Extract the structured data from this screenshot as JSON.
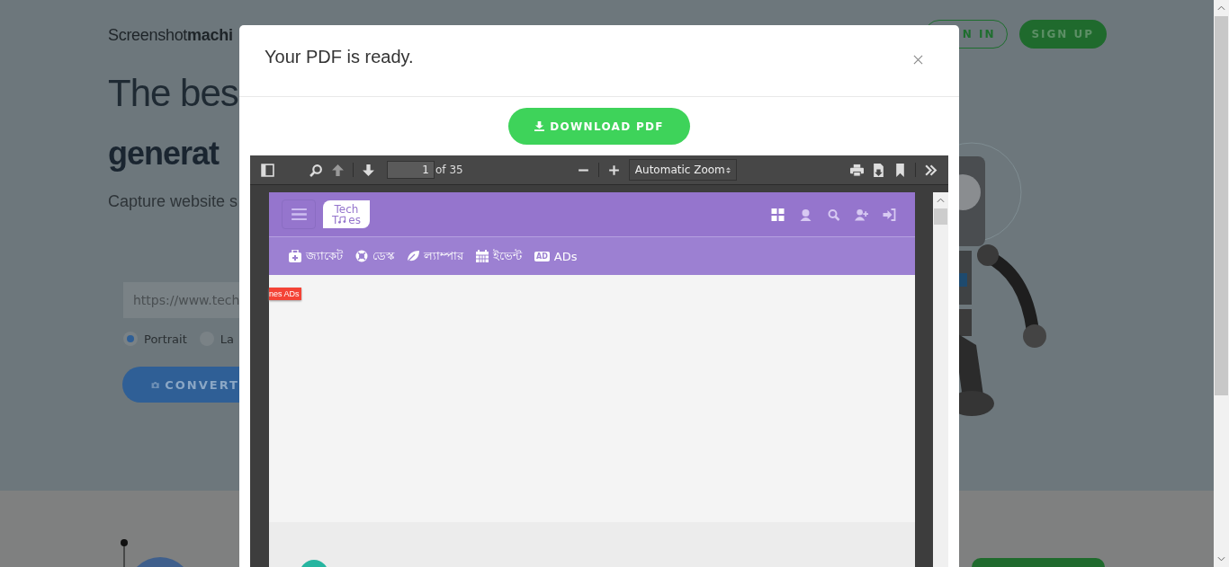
{
  "background_page": {
    "logo": "Screenshot**machi**",
    "heading_line_1": "The bes",
    "heading_line_2": "generat",
    "subtitle": "Capture website s",
    "url_field": {
      "value": "https://www.tech"
    },
    "orientation_options": [
      {
        "label": "Portrait",
        "selected": true
      },
      {
        "label": "La",
        "selected": false
      }
    ],
    "convert_button": "CONVERT",
    "account_buttons": [
      {
        "label": "N IN",
        "kind": "outline"
      },
      {
        "label": "SIGN UP",
        "kind": "filled"
      }
    ]
  },
  "modal": {
    "title": "Your PDF is ready.",
    "download_button": "DOWNLOAD PDF",
    "pdf_viewer": {
      "page_number": "1",
      "page_count": "of 35",
      "zoom": "Automatic Zoom",
      "document": {
        "logo_line_1": "Tech",
        "logo_line_2_start": "T",
        "logo_line_2_end": "es",
        "menu": [
          {
            "label": "জ্যাকেট",
            "kind": "medkit"
          },
          {
            "label": "ডেস্ক",
            "kind": "lifebuoy"
          },
          {
            "label": "ল্যাম্পার",
            "kind": "leaf"
          },
          {
            "label": "ইভেন্ট",
            "kind": "calendar"
          },
          {
            "label": "ADs",
            "kind": "ad",
            "badge": "AD"
          }
        ],
        "tag": "nes ADs"
      }
    }
  }
}
